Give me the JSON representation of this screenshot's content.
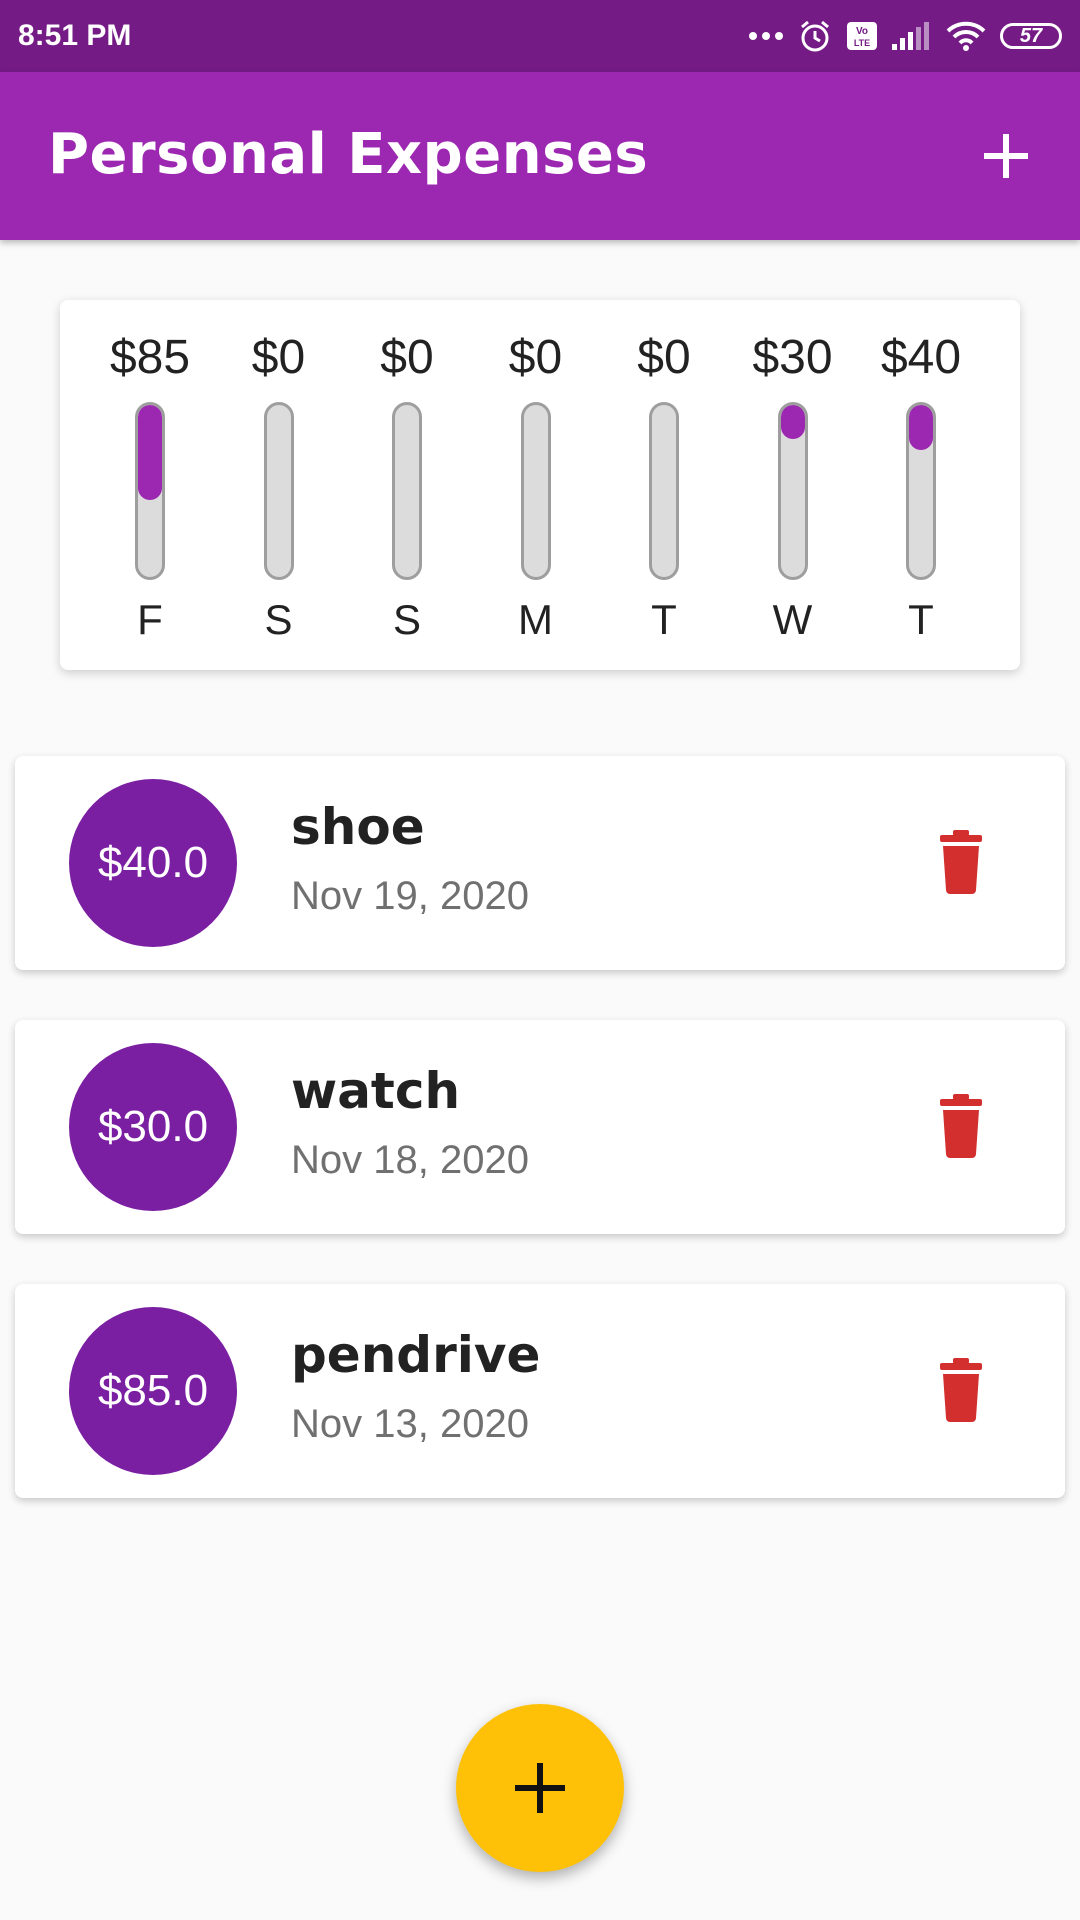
{
  "status_bar": {
    "time": "8:51 PM",
    "battery": "57",
    "icons": [
      "more-dots-icon",
      "alarm-icon",
      "volte-icon",
      "signal-icon",
      "wifi-icon",
      "battery-icon"
    ]
  },
  "app_bar": {
    "title": "Personal Expenses",
    "add_icon": "plus-icon"
  },
  "chart_data": {
    "type": "bar",
    "categories": [
      "F",
      "S",
      "S",
      "M",
      "T",
      "W",
      "T"
    ],
    "labels": [
      "$85",
      "$0",
      "$0",
      "$0",
      "$0",
      "$30",
      "$40"
    ],
    "values": [
      85,
      0,
      0,
      0,
      0,
      30,
      40
    ],
    "fill_fractions": [
      0.55,
      0,
      0,
      0,
      0,
      0.2,
      0.26
    ],
    "bar_color": "#9c27b0",
    "track_color": "#dcdcdc"
  },
  "transactions": [
    {
      "amount": "$40.0",
      "title": "shoe",
      "date": "Nov 19, 2020"
    },
    {
      "amount": "$30.0",
      "title": "watch",
      "date": "Nov 18, 2020"
    },
    {
      "amount": "$85.0",
      "title": "pendrive",
      "date": "Nov 13, 2020"
    }
  ],
  "colors": {
    "primary": "#9c27b0",
    "primary_dark": "#741b86",
    "avatar": "#7b1fa2",
    "accent": "#ffc107",
    "delete": "#d32f2f"
  },
  "fab": {
    "icon": "plus-icon"
  }
}
